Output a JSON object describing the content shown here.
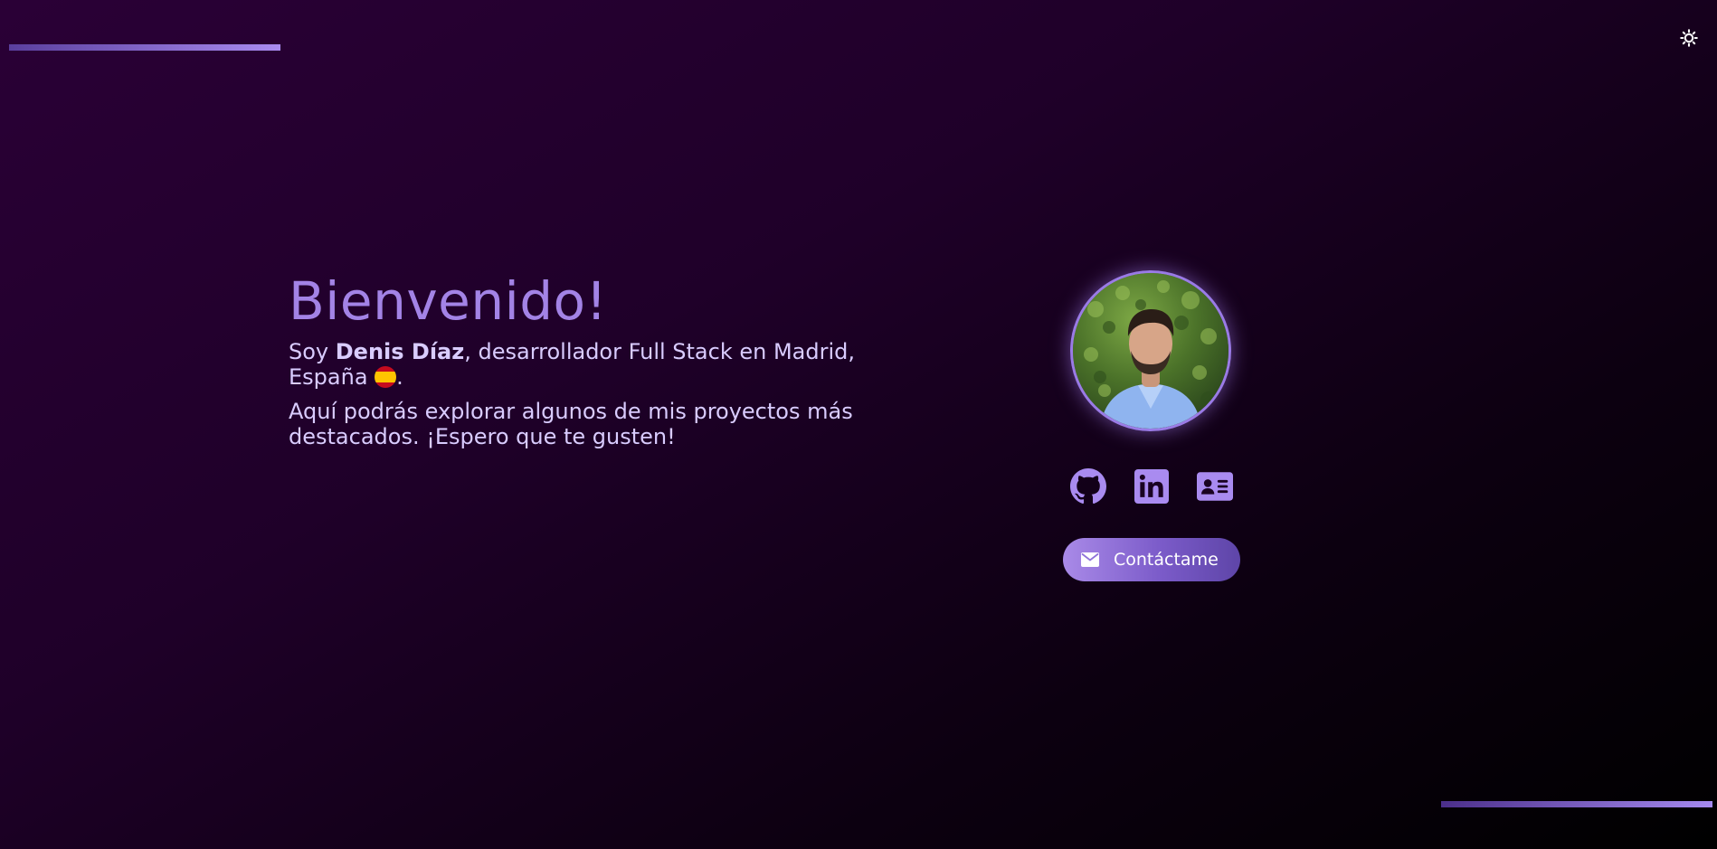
{
  "intro": {
    "title": "Bienvenido!",
    "line1_prefix": "Soy ",
    "name": "Denis Díaz",
    "line1_suffix": ", desarrollador Full Stack en Madrid, España",
    "line1_end": ".",
    "line2": "Aquí podrás explorar algunos de mis proyectos más destacados. ¡Espero que te gusten!"
  },
  "profile": {
    "socials": [
      {
        "icon": "github-icon"
      },
      {
        "icon": "linkedin-icon"
      },
      {
        "icon": "id-card-icon"
      }
    ],
    "contact_label": "Contáctame"
  },
  "theme": {
    "icon": "sun-icon"
  },
  "colors": {
    "accent": "#a383e6",
    "text": "#d9ccff",
    "background_start": "#2a0036",
    "background_end": "#000000"
  }
}
